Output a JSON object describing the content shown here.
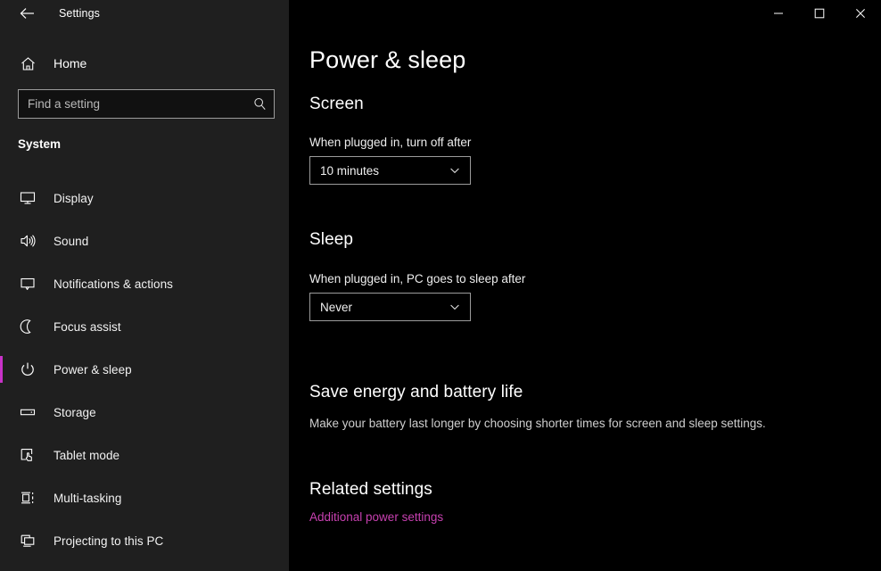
{
  "window": {
    "app_title": "Settings",
    "back_icon": "back-arrow-icon",
    "controls": {
      "minimize": "minimize-icon",
      "maximize": "maximize-icon",
      "close": "close-icon"
    }
  },
  "sidebar": {
    "home": {
      "label": "Home",
      "icon": "home-icon"
    },
    "search": {
      "placeholder": "Find a setting",
      "value": "",
      "icon": "search-icon"
    },
    "section_title": "System",
    "accent_color": "#c832c8",
    "items": [
      {
        "label": "Display",
        "icon": "monitor-icon",
        "selected": false
      },
      {
        "label": "Sound",
        "icon": "speaker-icon",
        "selected": false
      },
      {
        "label": "Notifications & actions",
        "icon": "chat-bubble-icon",
        "selected": false
      },
      {
        "label": "Focus assist",
        "icon": "moon-icon",
        "selected": false
      },
      {
        "label": "Power & sleep",
        "icon": "power-icon",
        "selected": true
      },
      {
        "label": "Storage",
        "icon": "drive-icon",
        "selected": false
      },
      {
        "label": "Tablet mode",
        "icon": "tablet-hand-icon",
        "selected": false
      },
      {
        "label": "Multi-tasking",
        "icon": "multitask-icon",
        "selected": false
      },
      {
        "label": "Projecting to this PC",
        "icon": "projecting-icon",
        "selected": false
      }
    ]
  },
  "main": {
    "page_title": "Power & sleep",
    "screen": {
      "heading": "Screen",
      "field_label": "When plugged in, turn off after",
      "value": "10 minutes",
      "chevron": "chevron-down-icon"
    },
    "sleep": {
      "heading": "Sleep",
      "field_label": "When plugged in, PC goes to sleep after",
      "value": "Never",
      "chevron": "chevron-down-icon"
    },
    "save_energy": {
      "heading": "Save energy and battery life",
      "description": "Make your battery last longer by choosing shorter times for screen and sleep settings."
    },
    "related_settings": {
      "heading": "Related settings",
      "link_label": "Additional power settings",
      "link_color": "#c740b0"
    }
  }
}
